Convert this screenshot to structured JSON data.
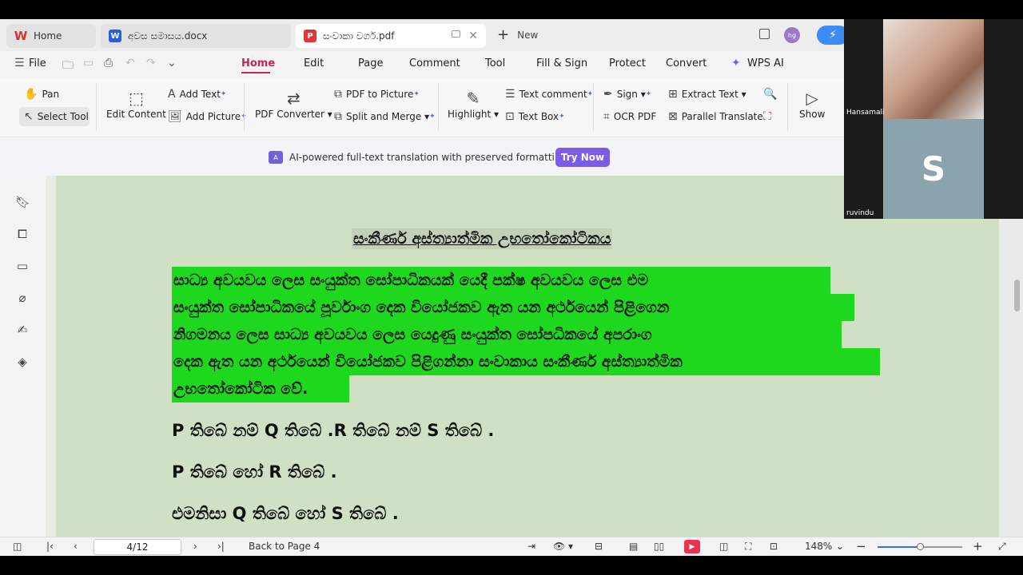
{
  "tabs": [
    {
      "label": "Home",
      "state": "inactive"
    },
    {
      "label": "අවස සමාසය.docx",
      "state": "inactive"
    },
    {
      "label": "සංවාකා වර්ග.pdf",
      "state": "active"
    }
  ],
  "new_tab_label": "New",
  "account_initials": "hg",
  "menu": {
    "file": "File",
    "items": [
      "Home",
      "Edit",
      "Page",
      "Comment",
      "Tool",
      "Fill & Sign",
      "Protect",
      "Convert"
    ],
    "active": "Home",
    "ai_label": "WPS AI"
  },
  "ribbon": {
    "pan": "Pan",
    "select_tool": "Select Tool",
    "edit_content": "Edit Content",
    "add_text": "Add Text",
    "add_picture": "Add Picture",
    "pdf_converter": "PDF Converter",
    "pdf_to_picture": "PDF to Picture",
    "split_merge": "Split and Merge",
    "highlight": "Highlight",
    "text_comment": "Text comment",
    "text_box": "Text Box",
    "sign": "Sign",
    "ocr_pdf": "OCR PDF",
    "extract_text": "Extract Text",
    "parallel_translate": "Parallel Translate",
    "show": "Show"
  },
  "banner": {
    "icon_text": "A",
    "text": "AI-powered full-text translation with preserved formatting.",
    "button": "Try Now"
  },
  "document": {
    "title": "සංකීර්ණ අස්ත්‍යාත්මික උභතෝකෝටිකය",
    "highlighted_lines": [
      "සාධ්‍ය  අවයවය  ලෙස  සංයුක්ත  සෝපාධිකයක්  යෙදී  පක්ෂ  අවයවය  ලෙස  එම",
      "සංයුක්ත  සෝපාධිකයේ  පූර්වාංග  දෙක  වියෝජකව  ඇත  යන  අර්ථයෙන්  පිළිගෙන",
      "නිගමනය  ලෙස  සාධ්‍ය  අවයවය  ලෙස  යෙදුණු  සංයුක්ත  සෝපධිකයේ  අපරාංග",
      "දෙක  ඇත  යන  අර්ථයෙන්  වියෝජකව  පිළිගන්නා  සංවාකාය   සංකීර්ණ  අස්ත්‍යාත්මික",
      "උභතෝකෝටික වේ."
    ],
    "logic_lines": [
      "P  තිබේ නම් Q තිබේ .R තිබේ නම් S තිබේ .",
      "P තිබේ  හෝ  R තිබේ .",
      "එමනිසා Q තිබේ  හෝ S තිබේ ."
    ]
  },
  "status": {
    "page": "4/12",
    "back_to_page": "Back to Page 4",
    "zoom": "148%",
    "zoom_fraction": 0.5
  },
  "video": {
    "participant1": "Hansamali",
    "participant2": "ruvindu",
    "participant2_initial": "S"
  },
  "colors": {
    "accent": "#c7254e",
    "highlight": "#1ed81e",
    "page_bg": "#cfe0c4",
    "try_now": "#7c5ce6"
  }
}
